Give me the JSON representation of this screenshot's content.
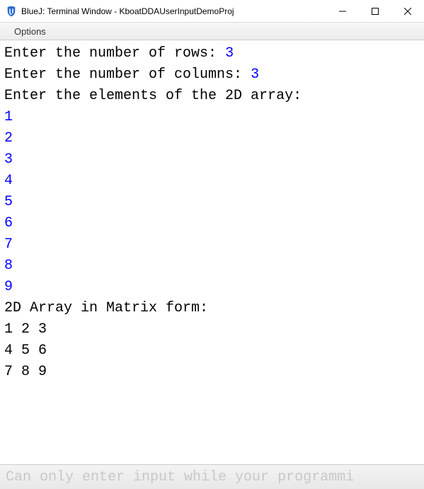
{
  "window": {
    "title": "BlueJ: Terminal Window - KboatDDAUserInputDemoProj",
    "controls": {
      "minimize": "minimize",
      "maximize": "maximize",
      "close": "close"
    }
  },
  "menubar": {
    "options": "Options"
  },
  "terminal": {
    "lines": [
      {
        "prompt": "Enter the number of rows: ",
        "input": "3"
      },
      {
        "prompt": "Enter the number of columns: ",
        "input": "3"
      },
      {
        "prompt": "Enter the elements of the 2D array:"
      },
      {
        "input": "1"
      },
      {
        "input": "2"
      },
      {
        "input": "3"
      },
      {
        "input": "4"
      },
      {
        "input": "5"
      },
      {
        "input": "6"
      },
      {
        "input": "7"
      },
      {
        "input": "8"
      },
      {
        "input": "9"
      },
      {
        "prompt": "2D Array in Matrix form:"
      },
      {
        "prompt": "1 2 3"
      },
      {
        "prompt": "4 5 6"
      },
      {
        "prompt": "7 8 9"
      }
    ]
  },
  "statusbar": {
    "message": "Can only enter input while your programmi"
  }
}
